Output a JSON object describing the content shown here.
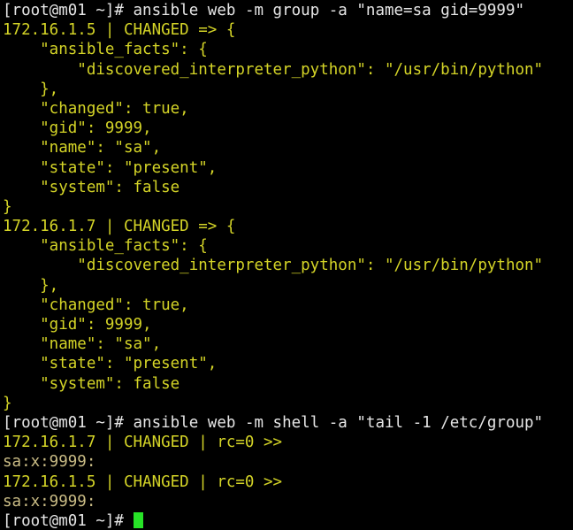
{
  "terminal": {
    "background": "#000000",
    "colors": {
      "prompt": "#e6e6e6",
      "command": "#e6e6e6",
      "status": "#d4d427",
      "json": "#d4d427",
      "stdout": "#cbbd86",
      "cursor": "#27e327"
    },
    "prompt_text": "[root@m01 ~]# ",
    "cursor_glyph": " ",
    "lines": [
      {
        "segments": [
          {
            "role": "prompt",
            "text": "[root@m01 ~]# "
          },
          {
            "role": "command",
            "text": "ansible web -m group -a \"name=sa gid=9999\""
          }
        ]
      },
      {
        "segments": [
          {
            "role": "status",
            "text": "172.16.1.5 | CHANGED => {"
          }
        ]
      },
      {
        "segments": [
          {
            "role": "json",
            "text": "    \"ansible_facts\": {"
          }
        ]
      },
      {
        "segments": [
          {
            "role": "json",
            "text": "        \"discovered_interpreter_python\": \"/usr/bin/python\""
          }
        ]
      },
      {
        "segments": [
          {
            "role": "json",
            "text": "    },"
          }
        ]
      },
      {
        "segments": [
          {
            "role": "json",
            "text": "    \"changed\": true,"
          }
        ]
      },
      {
        "segments": [
          {
            "role": "json",
            "text": "    \"gid\": 9999,"
          }
        ]
      },
      {
        "segments": [
          {
            "role": "json",
            "text": "    \"name\": \"sa\","
          }
        ]
      },
      {
        "segments": [
          {
            "role": "json",
            "text": "    \"state\": \"present\","
          }
        ]
      },
      {
        "segments": [
          {
            "role": "json",
            "text": "    \"system\": false"
          }
        ]
      },
      {
        "segments": [
          {
            "role": "json",
            "text": "}"
          }
        ]
      },
      {
        "segments": [
          {
            "role": "status",
            "text": "172.16.1.7 | CHANGED => {"
          }
        ]
      },
      {
        "segments": [
          {
            "role": "json",
            "text": "    \"ansible_facts\": {"
          }
        ]
      },
      {
        "segments": [
          {
            "role": "json",
            "text": "        \"discovered_interpreter_python\": \"/usr/bin/python\""
          }
        ]
      },
      {
        "segments": [
          {
            "role": "json",
            "text": "    },"
          }
        ]
      },
      {
        "segments": [
          {
            "role": "json",
            "text": "    \"changed\": true,"
          }
        ]
      },
      {
        "segments": [
          {
            "role": "json",
            "text": "    \"gid\": 9999,"
          }
        ]
      },
      {
        "segments": [
          {
            "role": "json",
            "text": "    \"name\": \"sa\","
          }
        ]
      },
      {
        "segments": [
          {
            "role": "json",
            "text": "    \"state\": \"present\","
          }
        ]
      },
      {
        "segments": [
          {
            "role": "json",
            "text": "    \"system\": false"
          }
        ]
      },
      {
        "segments": [
          {
            "role": "json",
            "text": "}"
          }
        ]
      },
      {
        "segments": [
          {
            "role": "prompt",
            "text": "[root@m01 ~]# "
          },
          {
            "role": "command",
            "text": "ansible web -m shell -a \"tail -1 /etc/group\""
          }
        ]
      },
      {
        "segments": [
          {
            "role": "status",
            "text": "172.16.1.7 | CHANGED | rc=0 >>"
          }
        ]
      },
      {
        "segments": [
          {
            "role": "stdout",
            "text": "sa:x:9999:"
          }
        ]
      },
      {
        "segments": [
          {
            "role": "status",
            "text": "172.16.1.5 | CHANGED | rc=0 >>"
          }
        ]
      },
      {
        "segments": [
          {
            "role": "stdout",
            "text": "sa:x:9999:"
          }
        ]
      },
      {
        "segments": [
          {
            "role": "prompt",
            "text": "[root@m01 ~]# "
          },
          {
            "role": "cursor",
            "text": " "
          }
        ]
      }
    ]
  }
}
